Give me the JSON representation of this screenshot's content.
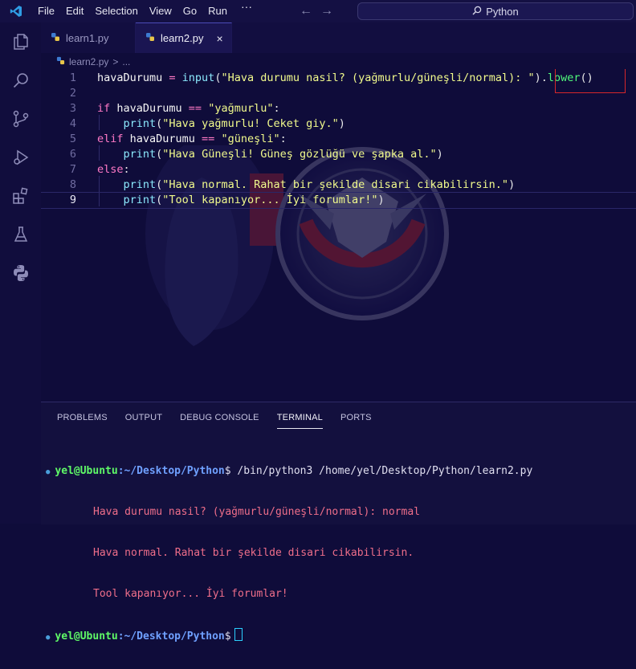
{
  "titlebar": {
    "menu": [
      "File",
      "Edit",
      "Selection",
      "View",
      "Go",
      "Run"
    ],
    "more": "···",
    "back": "←",
    "forward": "→",
    "search_text": "Python"
  },
  "tabs": [
    {
      "label": "learn1.py",
      "active": false
    },
    {
      "label": "learn2.py",
      "active": true,
      "close": "×"
    }
  ],
  "breadcrumb": {
    "file": "learn2.py",
    "sep": ">",
    "rest": "..."
  },
  "editor": {
    "line_numbers": [
      "1",
      "2",
      "3",
      "4",
      "5",
      "6",
      "7",
      "8",
      "9"
    ],
    "current_line": "9",
    "lines": [
      {
        "tokens": [
          [
            "var",
            "havaDurumu"
          ],
          [
            "op",
            " = "
          ],
          [
            "fn",
            "input"
          ],
          [
            "punc",
            "("
          ],
          [
            "str",
            "\"Hava durumu nasil? (yağmurlu/güneşli/normal): \""
          ],
          [
            "punc",
            ")"
          ],
          [
            "punc",
            "."
          ],
          [
            "meth",
            "lower"
          ],
          [
            "punc",
            "()"
          ]
        ]
      },
      {
        "tokens": []
      },
      {
        "tokens": [
          [
            "kw",
            "if "
          ],
          [
            "var",
            "havaDurumu "
          ],
          [
            "op",
            "== "
          ],
          [
            "str",
            "\"yağmurlu\""
          ],
          [
            "punc",
            ":"
          ]
        ]
      },
      {
        "tokens": [
          [
            "var",
            "    "
          ],
          [
            "fn",
            "print"
          ],
          [
            "punc",
            "("
          ],
          [
            "str",
            "\"Hava yağmurlu! Ceket giy.\""
          ],
          [
            "punc",
            ")"
          ]
        ]
      },
      {
        "tokens": [
          [
            "kw",
            "elif "
          ],
          [
            "var",
            "havaDurumu "
          ],
          [
            "op",
            "== "
          ],
          [
            "str",
            "\"güneşli\""
          ],
          [
            "punc",
            ":"
          ]
        ]
      },
      {
        "tokens": [
          [
            "var",
            "    "
          ],
          [
            "fn",
            "print"
          ],
          [
            "punc",
            "("
          ],
          [
            "str",
            "\"Hava Güneşli! Güneş gözlüğü ve şapka al.\""
          ],
          [
            "punc",
            ")"
          ]
        ]
      },
      {
        "tokens": [
          [
            "kw",
            "else"
          ],
          [
            "punc",
            ":"
          ]
        ]
      },
      {
        "tokens": [
          [
            "var",
            "    "
          ],
          [
            "fn",
            "print"
          ],
          [
            "punc",
            "("
          ],
          [
            "str",
            "\"Hava normal. Rahat bir şekilde disari cikabilirsin.\""
          ],
          [
            "punc",
            ")"
          ]
        ]
      },
      {
        "tokens": [
          [
            "var",
            "    "
          ],
          [
            "fn",
            "print"
          ],
          [
            "punc",
            "("
          ],
          [
            "str",
            "\"Tool kapanıyor... İyi forumlar!\""
          ],
          [
            "punc",
            ")"
          ]
        ]
      }
    ]
  },
  "panel": {
    "tabs": [
      "PROBLEMS",
      "OUTPUT",
      "DEBUG CONSOLE",
      "TERMINAL",
      "PORTS"
    ],
    "active_tab": "TERMINAL",
    "terminal": {
      "user": "yel@Ubuntu",
      "path": ":~/Desktop/Python",
      "prompt_suffix": "$",
      "command": " /bin/python3 /home/yel/Desktop/Python/learn2.py",
      "output": [
        "Hava durumu nasil? (yağmurlu/güneşli/normal): normal",
        "Hava normal. Rahat bir şekilde disari cikabilirsin.",
        "Tool kapanıyor... İyi forumlar!"
      ]
    }
  },
  "colors": {
    "background": "#0f0c3a",
    "string": "#f1fa8c",
    "keyword": "#ff79c6",
    "function": "#8be9fd",
    "method": "#50fa7b",
    "highlight_box": "#d6262a"
  },
  "icons": {
    "activity_bar": [
      "explorer-icon",
      "search-icon",
      "source-control-icon",
      "run-debug-icon",
      "extensions-icon",
      "testing-icon",
      "python-icon"
    ]
  }
}
